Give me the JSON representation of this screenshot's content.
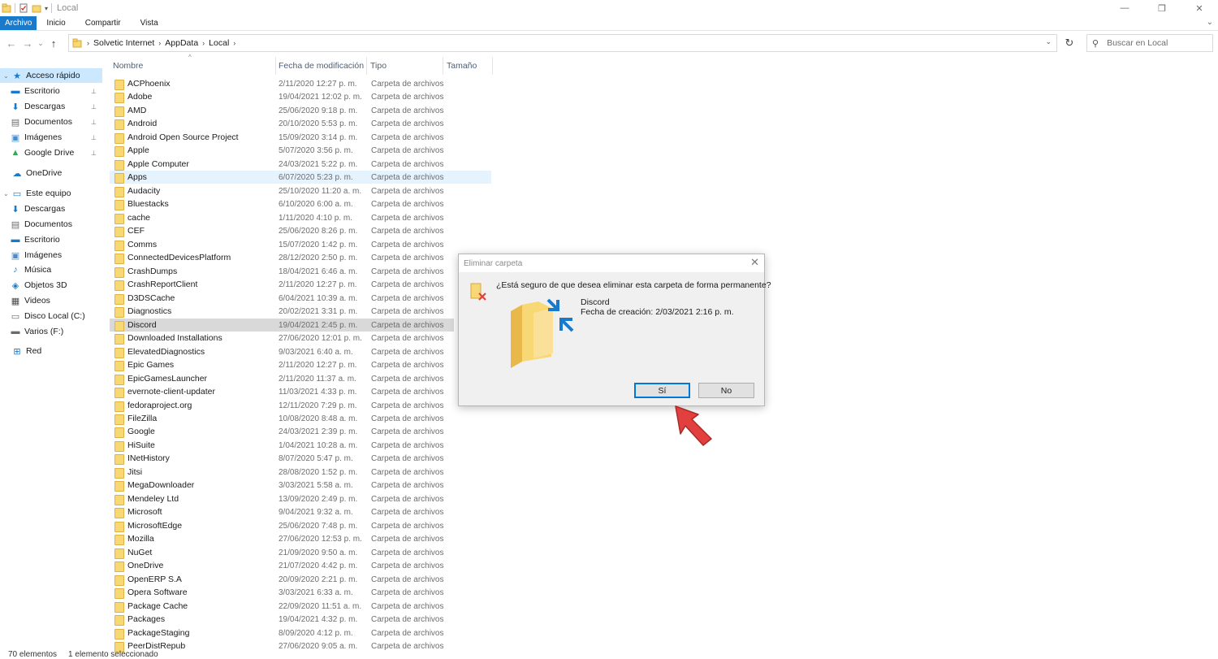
{
  "window": {
    "title": "Local",
    "ctl_min": "—",
    "ctl_max": "❐",
    "ctl_close": "✕"
  },
  "ribbon": {
    "tabs": [
      "Archivo",
      "Inicio",
      "Compartir",
      "Vista"
    ],
    "expand": "⌄"
  },
  "address": {
    "crumbs": [
      "Solvetic Internet",
      "AppData",
      "Local"
    ],
    "dropdown": "⌄",
    "refresh": "↻",
    "back": "←",
    "forward": "→",
    "recent": "⌄",
    "up": "↑"
  },
  "search": {
    "placeholder": "Buscar en Local",
    "icon": "⚲"
  },
  "sidebar": {
    "items": [
      {
        "label": "Acceso rápido",
        "icon": "star-icon",
        "glyph": "★",
        "color": "#1979ca",
        "pinned": false,
        "expander": "⌄"
      },
      {
        "label": "Escritorio",
        "icon": "desktop-icon",
        "glyph": "▬",
        "color": "#1979ca",
        "pinned": true
      },
      {
        "label": "Descargas",
        "icon": "download-icon",
        "glyph": "⬇",
        "color": "#1979ca",
        "pinned": true
      },
      {
        "label": "Documentos",
        "icon": "documents-icon",
        "glyph": "▤",
        "color": "#6b6b6b",
        "pinned": true
      },
      {
        "label": "Imágenes",
        "icon": "pictures-icon",
        "glyph": "▣",
        "color": "#4a8ccc",
        "pinned": true
      },
      {
        "label": "Google Drive",
        "icon": "google-drive-icon",
        "glyph": "▲",
        "color": "#34a853",
        "pinned": true
      },
      {
        "label": "OneDrive",
        "icon": "cloud-icon",
        "glyph": "☁",
        "color": "#1979ca",
        "pinned": false
      },
      {
        "label": "Este equipo",
        "icon": "computer-icon",
        "glyph": "▭",
        "color": "#1979ca",
        "pinned": false,
        "expander": "⌄"
      },
      {
        "label": "Descargas",
        "icon": "download-icon",
        "glyph": "⬇",
        "color": "#1979ca",
        "pinned": false
      },
      {
        "label": "Documentos",
        "icon": "documents-icon",
        "glyph": "▤",
        "color": "#6b6b6b",
        "pinned": false
      },
      {
        "label": "Escritorio",
        "icon": "desktop-icon",
        "glyph": "▬",
        "color": "#1979ca",
        "pinned": false
      },
      {
        "label": "Imágenes",
        "icon": "pictures-icon",
        "glyph": "▣",
        "color": "#4a8ccc",
        "pinned": false
      },
      {
        "label": "Música",
        "icon": "music-icon",
        "glyph": "♪",
        "color": "#1979ca",
        "pinned": false
      },
      {
        "label": "Objetos 3D",
        "icon": "3d-objects-icon",
        "glyph": "◈",
        "color": "#1979ca",
        "pinned": false
      },
      {
        "label": "Videos",
        "icon": "videos-icon",
        "glyph": "▦",
        "color": "#4a4a4a",
        "pinned": false
      },
      {
        "label": "Disco Local (C:)",
        "icon": "drive-icon",
        "glyph": "▭",
        "color": "#6b6b6b",
        "pinned": false
      },
      {
        "label": "Varios (F:)",
        "icon": "drive-icon",
        "glyph": "▬",
        "color": "#6b6b6b",
        "pinned": false
      },
      {
        "label": "Red",
        "icon": "network-icon",
        "glyph": "⊞",
        "color": "#1979ca",
        "pinned": false
      }
    ],
    "pin_glyph": "📌"
  },
  "columns": {
    "name": "Nombre",
    "date": "Fecha de modificación",
    "type": "Tipo",
    "size": "Tamaño",
    "sort_glyph": "^"
  },
  "files": [
    {
      "name": "ACPhoenix",
      "date": "2/11/2020 12:27 p. m.",
      "type": "Carpeta de archivos"
    },
    {
      "name": "Adobe",
      "date": "19/04/2021 12:02 p. m.",
      "type": "Carpeta de archivos"
    },
    {
      "name": "AMD",
      "date": "25/06/2020 9:18 p. m.",
      "type": "Carpeta de archivos"
    },
    {
      "name": "Android",
      "date": "20/10/2020 5:53 p. m.",
      "type": "Carpeta de archivos"
    },
    {
      "name": "Android Open Source Project",
      "date": "15/09/2020 3:14 p. m.",
      "type": "Carpeta de archivos"
    },
    {
      "name": "Apple",
      "date": "5/07/2020 3:56 p. m.",
      "type": "Carpeta de archivos"
    },
    {
      "name": "Apple Computer",
      "date": "24/03/2021 5:22 p. m.",
      "type": "Carpeta de archivos"
    },
    {
      "name": "Apps",
      "date": "6/07/2020 5:23 p. m.",
      "type": "Carpeta de archivos",
      "state": "hover"
    },
    {
      "name": "Audacity",
      "date": "25/10/2020 11:20 a. m.",
      "type": "Carpeta de archivos"
    },
    {
      "name": "Bluestacks",
      "date": "6/10/2020 6:00 a. m.",
      "type": "Carpeta de archivos"
    },
    {
      "name": "cache",
      "date": "1/11/2020 4:10 p. m.",
      "type": "Carpeta de archivos"
    },
    {
      "name": "CEF",
      "date": "25/06/2020 8:26 p. m.",
      "type": "Carpeta de archivos"
    },
    {
      "name": "Comms",
      "date": "15/07/2020 1:42 p. m.",
      "type": "Carpeta de archivos"
    },
    {
      "name": "ConnectedDevicesPlatform",
      "date": "28/12/2020 2:50 p. m.",
      "type": "Carpeta de archivos"
    },
    {
      "name": "CrashDumps",
      "date": "18/04/2021 6:46 a. m.",
      "type": "Carpeta de archivos"
    },
    {
      "name": "CrashReportClient",
      "date": "2/11/2020 12:27 p. m.",
      "type": "Carpeta de archivos"
    },
    {
      "name": "D3DSCache",
      "date": "6/04/2021 10:39 a. m.",
      "type": "Carpeta de archivos"
    },
    {
      "name": "Diagnostics",
      "date": "20/02/2021 3:31 p. m.",
      "type": "Carpeta de archivos"
    },
    {
      "name": "Discord",
      "date": "19/04/2021 2:45 p. m.",
      "type": "Carpeta de archivos",
      "state": "selected"
    },
    {
      "name": "Downloaded Installations",
      "date": "27/06/2020 12:01 p. m.",
      "type": "Carpeta de archivos"
    },
    {
      "name": "ElevatedDiagnostics",
      "date": "9/03/2021 6:40 a. m.",
      "type": "Carpeta de archivos"
    },
    {
      "name": "Epic Games",
      "date": "2/11/2020 12:27 p. m.",
      "type": "Carpeta de archivos"
    },
    {
      "name": "EpicGamesLauncher",
      "date": "2/11/2020 11:37 a. m.",
      "type": "Carpeta de archivos"
    },
    {
      "name": "evernote-client-updater",
      "date": "11/03/2021 4:33 p. m.",
      "type": "Carpeta de archivos"
    },
    {
      "name": "fedoraproject.org",
      "date": "12/11/2020 7:29 p. m.",
      "type": "Carpeta de archivos"
    },
    {
      "name": "FileZilla",
      "date": "10/08/2020 8:48 a. m.",
      "type": "Carpeta de archivos"
    },
    {
      "name": "Google",
      "date": "24/03/2021 2:39 p. m.",
      "type": "Carpeta de archivos"
    },
    {
      "name": "HiSuite",
      "date": "1/04/2021 10:28 a. m.",
      "type": "Carpeta de archivos"
    },
    {
      "name": "INetHistory",
      "date": "8/07/2020 5:47 p. m.",
      "type": "Carpeta de archivos"
    },
    {
      "name": "Jitsi",
      "date": "28/08/2020 1:52 p. m.",
      "type": "Carpeta de archivos"
    },
    {
      "name": "MegaDownloader",
      "date": "3/03/2021 5:58 a. m.",
      "type": "Carpeta de archivos"
    },
    {
      "name": "Mendeley Ltd",
      "date": "13/09/2020 2:49 p. m.",
      "type": "Carpeta de archivos"
    },
    {
      "name": "Microsoft",
      "date": "9/04/2021 9:32 a. m.",
      "type": "Carpeta de archivos"
    },
    {
      "name": "MicrosoftEdge",
      "date": "25/06/2020 7:48 p. m.",
      "type": "Carpeta de archivos"
    },
    {
      "name": "Mozilla",
      "date": "27/06/2020 12:53 p. m.",
      "type": "Carpeta de archivos"
    },
    {
      "name": "NuGet",
      "date": "21/09/2020 9:50 a. m.",
      "type": "Carpeta de archivos"
    },
    {
      "name": "OneDrive",
      "date": "21/07/2020 4:42 p. m.",
      "type": "Carpeta de archivos"
    },
    {
      "name": "OpenERP S.A",
      "date": "20/09/2020 2:21 p. m.",
      "type": "Carpeta de archivos"
    },
    {
      "name": "Opera Software",
      "date": "3/03/2021 6:33 a. m.",
      "type": "Carpeta de archivos"
    },
    {
      "name": "Package Cache",
      "date": "22/09/2020 11:51 a. m.",
      "type": "Carpeta de archivos"
    },
    {
      "name": "Packages",
      "date": "19/04/2021 4:32 p. m.",
      "type": "Carpeta de archivos"
    },
    {
      "name": "PackageStaging",
      "date": "8/09/2020 4:12 p. m.",
      "type": "Carpeta de archivos"
    },
    {
      "name": "PeerDistRepub",
      "date": "27/06/2020 9:05 a. m.",
      "type": "Carpeta de archivos"
    }
  ],
  "status": {
    "count": "70 elementos",
    "selection": "1 elemento seleccionado"
  },
  "dialog": {
    "title": "Eliminar carpeta",
    "close": "✕",
    "question": "¿Está seguro de que desea eliminar esta carpeta de forma permanente?",
    "item_name": "Discord",
    "created": "Fecha de creación: 2/03/2021 2:16 p. m.",
    "yes_label": "Sí",
    "no_label": "No"
  },
  "colors": {
    "accent": "#1979ca",
    "folder": "#f8d775",
    "selected_row": "#d9d9d9",
    "hover_row": "#e5f3ff",
    "annotation_arrow": "#e2403f"
  }
}
